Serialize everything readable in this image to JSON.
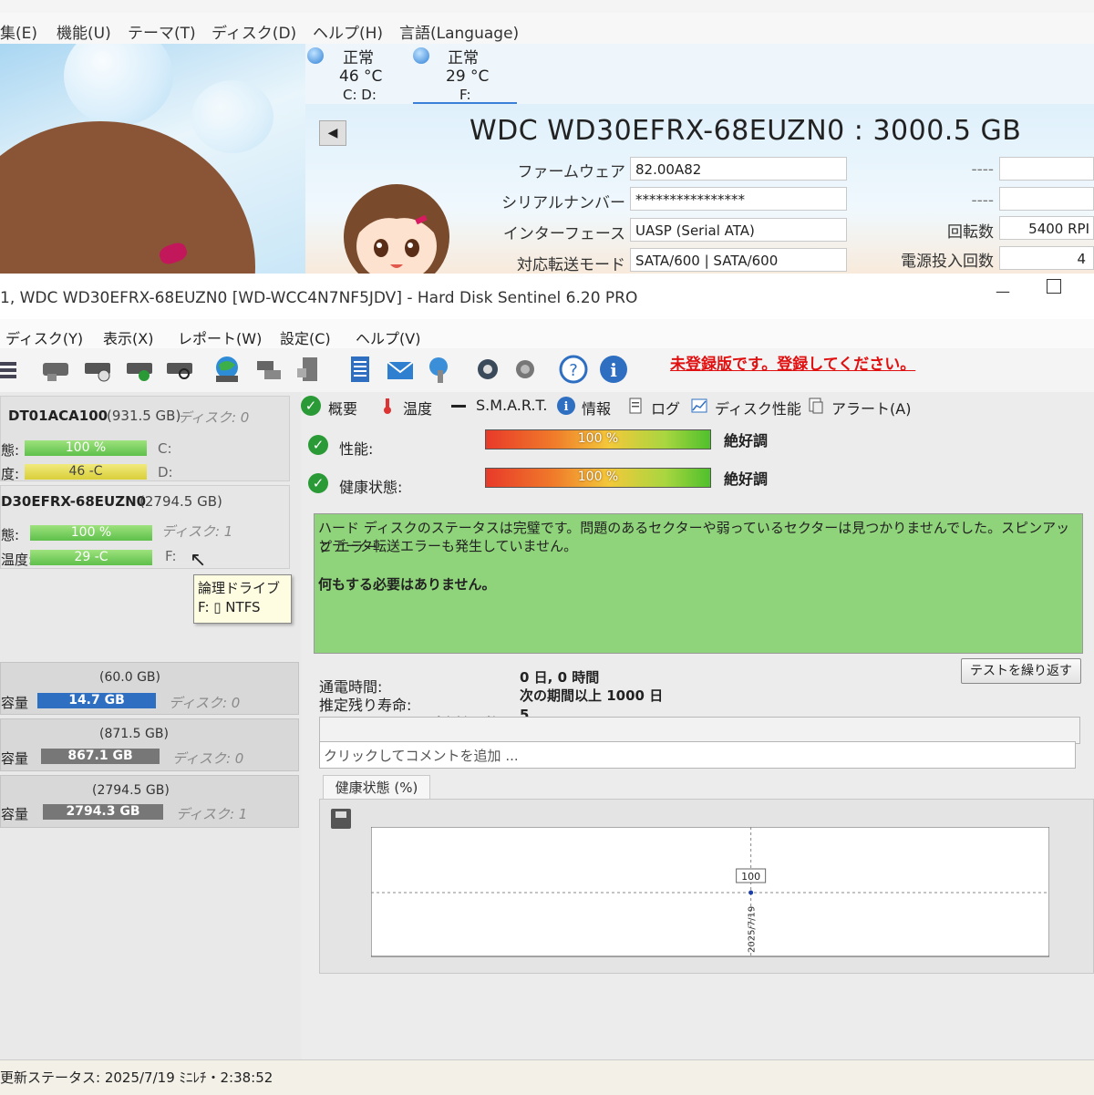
{
  "cdi": {
    "menu": [
      "集(E)",
      "機能(U)",
      "テーマ(T)",
      "ディスク(D)",
      "ヘルプ(H)",
      "言語(Language)"
    ],
    "disks": [
      {
        "status": "正常",
        "temp": "46 °C",
        "drives": "C: D:"
      },
      {
        "status": "正常",
        "temp": "29 °C",
        "drives": "F:"
      }
    ],
    "model": "WDC WD30EFRX-68EUZN0 : 3000.5 GB",
    "labels": {
      "firmware": "ファームウェア",
      "serial": "シリアルナンバー",
      "interface": "インターフェース",
      "transfer": "対応転送モード",
      "rotation": "回転数",
      "power_count": "電源投入回数"
    },
    "values": {
      "firmware": "82.00A82",
      "serial": "****************",
      "interface": "UASP (Serial ATA)",
      "transfer": "SATA/600 | SATA/600",
      "dash1": "----",
      "dash2": "----",
      "rotation": "5400 RPI",
      "power_count": "4"
    },
    "back_icon": "◀"
  },
  "hds": {
    "title": "1, WDC WD30EFRX-68EUZN0 [WD-WCC4N7NF5JDV]  -  Hard Disk Sentinel 6.20 PRO",
    "menu": [
      "ディスク(Y)",
      "表示(X)",
      "レポート(W)",
      "設定(C)",
      "ヘルプ(V)"
    ],
    "unregistered": "未登録版です。登録してください。",
    "disks": [
      {
        "name": "DT01ACA100",
        "size": "(931.5 GB)",
        "disk": "ディスク: 0",
        "perf_label": "態:",
        "perf": "100 %",
        "temp_label": "度:",
        "temp": "46 -C",
        "drv1": "C:",
        "drv2": "D:"
      },
      {
        "name": "D30EFRX-68EUZN0",
        "size": "(2794.5 GB)",
        "disk": "ディスク: 1",
        "perf_label": "態:",
        "perf": "100 %",
        "temp_label": "温度:",
        "temp": "29 -C",
        "drv1": "F:"
      }
    ],
    "tooltip": {
      "line1": "論理ドライブ",
      "line2": "F: ▯ NTFS"
    },
    "volumes": [
      {
        "size": "(60.0 GB)",
        "label": "容量",
        "free": "14.7 GB",
        "disk": "ディスク: 0"
      },
      {
        "size": "(871.5 GB)",
        "label": "容量",
        "free": "867.1 GB",
        "disk": "ディスク: 0"
      },
      {
        "size": "(2794.5 GB)",
        "label": "容量",
        "free": "2794.3 GB",
        "disk": "ディスク: 1"
      }
    ],
    "tabs": [
      "概要",
      "温度",
      "S.M.A.R.T.",
      "情報",
      "ログ",
      "ディスク性能",
      "アラート(A)"
    ],
    "performance": {
      "label": "性能:",
      "value": "100 %",
      "verdict": "絶好調",
      "percent": 100
    },
    "health": {
      "label": "健康状態:",
      "value": "100 %",
      "verdict": "絶好調",
      "percent": 100
    },
    "status_text_1": "ハード ディスクのステータスは完璧です。問題のあるセクターや弱っているセクターは見つかりませんでした。スピンアップ エラー",
    "status_text_2": "とデータ転送エラーも発生していません。",
    "status_text_3": "何もする必要はありません。",
    "retest": "テストを繰り返す",
    "info": [
      {
        "label": "通電時間:",
        "value": "0 日, 0 時間"
      },
      {
        "label": "推定残り寿命:",
        "value": "次の期間以上 1000 日"
      },
      {
        "label": "スタート/ストップ合計回数:",
        "value": "5"
      }
    ],
    "comment_placeholder": "クリックしてコメントを追加 ...",
    "health_tab": "健康状態 (%)",
    "statusbar": "更新ステータス: 2025/7/19 ﾐﾆﾚﾁ・2:38:52"
  },
  "chart_data": {
    "type": "line",
    "x": [
      "2025/7/19"
    ],
    "series": [
      {
        "values": [
          100
        ]
      }
    ],
    "data_labels": [
      "100"
    ],
    "ylabel_tick": "100",
    "ylim": [
      0,
      100
    ]
  }
}
